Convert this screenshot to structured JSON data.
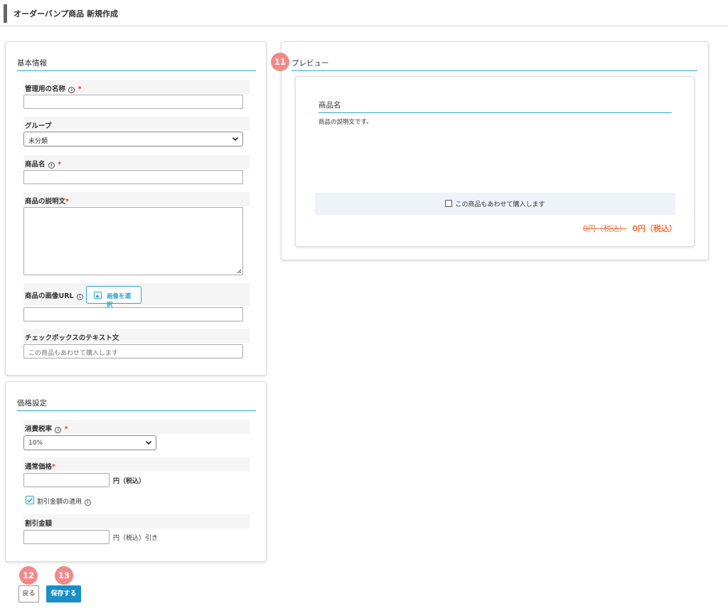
{
  "header": {
    "title": "オーダーバンプ商品 新規作成"
  },
  "basic_info": {
    "section_title": "基本情報",
    "admin_name": {
      "label": "管理用の名称",
      "value": ""
    },
    "group": {
      "label": "グループ",
      "selected": "未分類"
    },
    "product_name": {
      "label": "商品名",
      "value": ""
    },
    "description": {
      "label": "商品の説明文",
      "value": ""
    },
    "image_url": {
      "label": "商品の画像URL",
      "button_label": "画像を選択",
      "value": ""
    },
    "checkbox_text": {
      "label": "チェックボックスのテキスト文",
      "placeholder": "この商品もあわせて購入します"
    }
  },
  "price_settings": {
    "section_title": "価格設定",
    "tax_rate": {
      "label": "消費税率",
      "selected": "10%"
    },
    "regular_price": {
      "label": "通常価格",
      "value": "",
      "unit": "円（税込）"
    },
    "apply_discount": {
      "label": "割引金額の適用",
      "checked": true
    },
    "discount_amount": {
      "label": "割引金額",
      "value": "",
      "unit": "円（税込）引き"
    }
  },
  "preview": {
    "section_title": "プレビュー",
    "product_name": "商品名",
    "description": "商品の説明文です。",
    "checkbox_label": "この商品もあわせて購入します",
    "original_price": "0円（税込）",
    "final_price": "0円（税込）"
  },
  "required_mark": "*",
  "info_glyph": "i",
  "actions": {
    "back_label": "戻る",
    "save_label": "保存する"
  },
  "badges": {
    "preview": "11",
    "back": "12",
    "save": "13"
  },
  "colors": {
    "accent": "#2ba6cb",
    "save_button": "#1b8fc4",
    "required": "#e53935",
    "price": "#f07040",
    "badge": "#f08a8a",
    "preview_checkbox_bg": "#eef3fa"
  }
}
